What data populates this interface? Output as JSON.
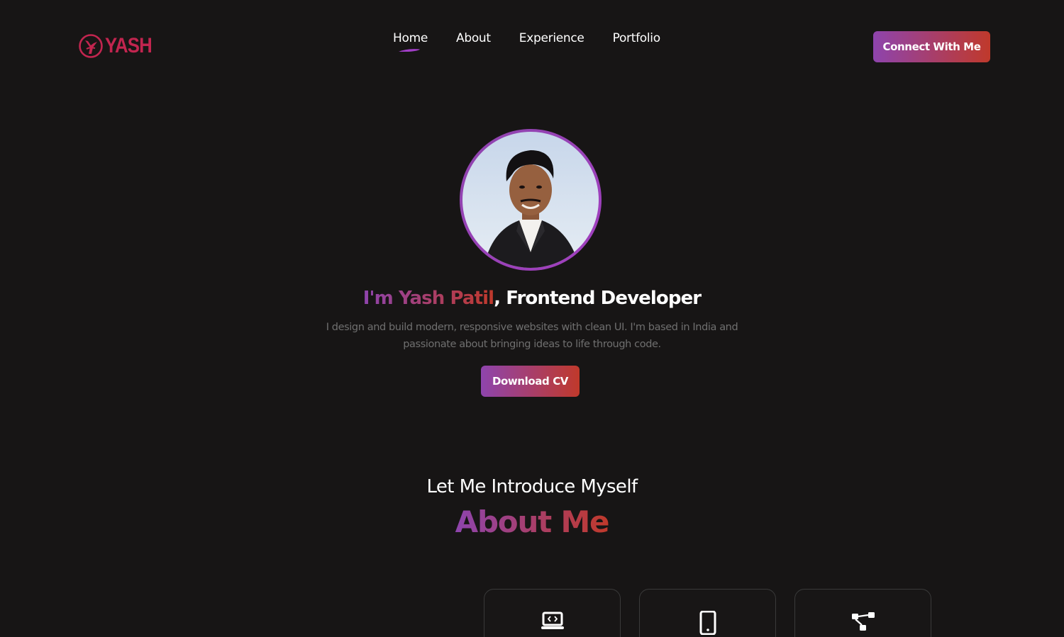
{
  "brand": {
    "logo_text": "YASH",
    "logo_icon": "falcon-logo-icon",
    "color": "#c2254f"
  },
  "nav": {
    "items": [
      {
        "label": "Home",
        "active": true
      },
      {
        "label": "About"
      },
      {
        "label": "Experience"
      },
      {
        "label": "Portfolio"
      }
    ],
    "cta_label": "Connect With Me"
  },
  "hero": {
    "avatar_alt": "profile-photo",
    "name_prefix": "I'm Yash Patil",
    "title_suffix": ", Frontend Developer",
    "description": "I design and build modern, responsive websites with clean UI. I'm based in India and passionate about bringing ideas to life through code.",
    "cv_label": "Download CV"
  },
  "about": {
    "intro": "Let Me Introduce Myself",
    "heading": "About Me",
    "cards": [
      {
        "icon": "laptop-code-icon"
      },
      {
        "icon": "mobile-phone-icon"
      },
      {
        "icon": "sitemap-icon"
      }
    ]
  },
  "colors": {
    "background": "#171515",
    "gradient_start": "#8e44ad",
    "gradient_end": "#c0392b",
    "muted_text": "#6f6f6f"
  }
}
